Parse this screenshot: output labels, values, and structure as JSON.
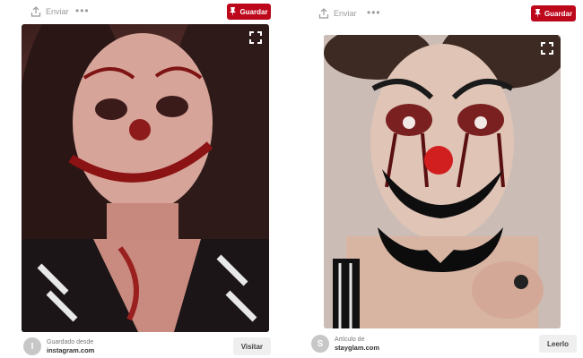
{
  "pins": [
    {
      "send_label": "Enviar",
      "more_icon": "more-icon",
      "save_label": "Guardar",
      "image": {
        "description_icon": "expand-icon"
      },
      "source": {
        "avatar_letter": "I",
        "label": "Guardado desde",
        "site": "instagram.com"
      },
      "action_label": "Visitar"
    },
    {
      "send_label": "Enviar",
      "more_icon": "more-icon",
      "save_label": "Guardar",
      "image": {
        "description_icon": "expand-icon"
      },
      "source": {
        "avatar_letter": "S",
        "label": "Artículo de",
        "site": "stayglam.com"
      },
      "action_label": "Leerlo"
    }
  ],
  "colors": {
    "brand": "#bd081c",
    "muted": "#9a9a9a",
    "button_bg": "#efefef"
  }
}
